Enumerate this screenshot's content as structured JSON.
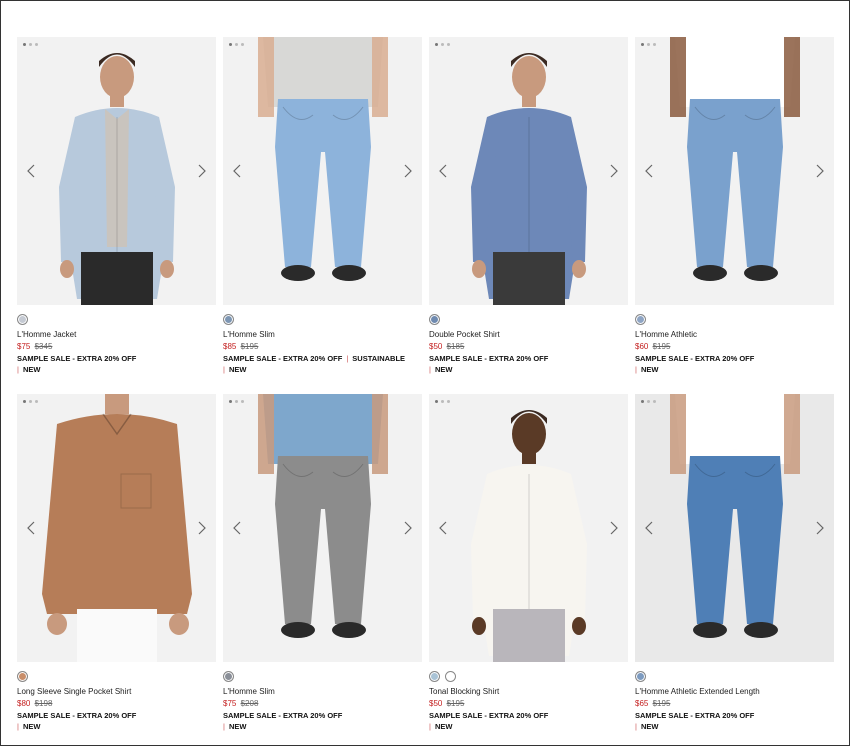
{
  "products": [
    {
      "name": "L'Homme Jacket",
      "sale_price": "$75",
      "original_price": "$345",
      "promo": "SAMPLE SALE - EXTRA 20% OFF",
      "extra_tag": "",
      "badge": "NEW",
      "swatches": [
        "#c5cad3"
      ],
      "photo": {
        "bg": "#f2f2f2",
        "top": "#b7c9dc",
        "inner": "#c9c4be",
        "bottom": "#2a2a2a",
        "skin": "#c89a7e",
        "kind": "jacket"
      }
    },
    {
      "name": "L'Homme Slim",
      "sale_price": "$85",
      "original_price": "$195",
      "promo": "SAMPLE SALE - EXTRA 20% OFF",
      "extra_tag": "SUSTAINABLE",
      "badge": "NEW",
      "swatches": [
        "#7d96b3"
      ],
      "photo": {
        "bg": "#f2f2f2",
        "top": "#d8d8d6",
        "inner": "#d8d8d6",
        "bottom": "#8db3db",
        "skin": "#d9ae92",
        "kind": "jeans"
      }
    },
    {
      "name": "Double Pocket Shirt",
      "sale_price": "$50",
      "original_price": "$185",
      "promo": "SAMPLE SALE - EXTRA 20% OFF",
      "extra_tag": "",
      "badge": "NEW",
      "swatches": [
        "#6f8ab0"
      ],
      "photo": {
        "bg": "#f2f2f2",
        "top": "#6d88b8",
        "inner": "#6d88b8",
        "bottom": "#3a3a3a",
        "skin": "#c89a7e",
        "kind": "shirt"
      }
    },
    {
      "name": "L'Homme Athletic",
      "sale_price": "$60",
      "original_price": "$195",
      "promo": "SAMPLE SALE - EXTRA 20% OFF",
      "extra_tag": "",
      "badge": "NEW",
      "swatches": [
        "#8fa5c4"
      ],
      "photo": {
        "bg": "#f2f2f2",
        "top": "#ffffff",
        "inner": "#ffffff",
        "bottom": "#7aa1cd",
        "skin": "#8a5a3e",
        "kind": "jeans"
      }
    },
    {
      "name": "Long Sleeve Single Pocket Shirt",
      "sale_price": "$80",
      "original_price": "$198",
      "promo": "SAMPLE SALE - EXTRA 20% OFF",
      "extra_tag": "",
      "badge": "NEW",
      "swatches": [
        "#c98e6a"
      ],
      "photo": {
        "bg": "#f2f2f2",
        "top": "#b67d58",
        "inner": "#b67d58",
        "bottom": "#fafafa",
        "skin": "#c89a7e",
        "kind": "shirt-crop"
      }
    },
    {
      "name": "L'Homme Slim",
      "sale_price": "$75",
      "original_price": "$208",
      "promo": "SAMPLE SALE - EXTRA 20% OFF",
      "extra_tag": "",
      "badge": "NEW",
      "swatches": [
        "#8a8f98"
      ],
      "photo": {
        "bg": "#f2f2f2",
        "top": "#7ea7cc",
        "inner": "#7ea7cc",
        "bottom": "#8c8c8c",
        "skin": "#c89a7e",
        "kind": "jeans"
      }
    },
    {
      "name": "Tonal Blocking Shirt",
      "sale_price": "$50",
      "original_price": "$195",
      "promo": "SAMPLE SALE - EXTRA 20% OFF",
      "extra_tag": "",
      "badge": "NEW",
      "swatches": [
        "#a9c3d6",
        "#ffffff"
      ],
      "photo": {
        "bg": "#f2f2f2",
        "top": "#f7f5f0",
        "inner": "#f7f5f0",
        "bottom": "#b9b6bb",
        "skin": "#5a3a26",
        "kind": "shirt"
      }
    },
    {
      "name": "L'Homme Athletic Extended Length",
      "sale_price": "$65",
      "original_price": "$195",
      "promo": "SAMPLE SALE - EXTRA 20% OFF",
      "extra_tag": "",
      "badge": "NEW",
      "swatches": [
        "#7d9bc0"
      ],
      "photo": {
        "bg": "#e9e9e9",
        "top": "#ffffff",
        "inner": "#ffffff",
        "bottom": "#4f7fb6",
        "skin": "#c89a7e",
        "kind": "jeans"
      }
    }
  ]
}
